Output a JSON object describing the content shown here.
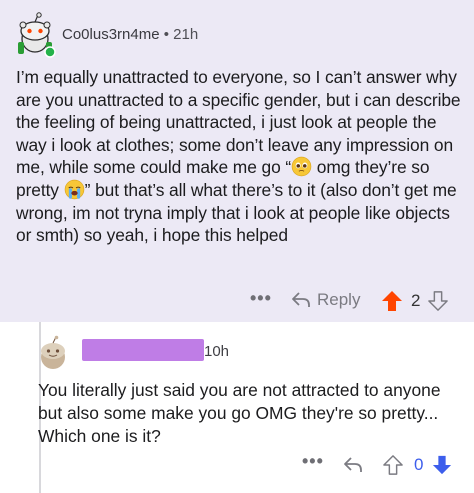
{
  "comment1": {
    "username": "Co0lus3rn4me",
    "separator": "•",
    "time": "21h",
    "text_parts": [
      "I’m equally unattracted to everyone, so I can’t answer why are you unattracted to a specific gender, but i can describe the feeling of being unattracted, i just look at people the way i look at clothes; some don’t leave any impression on me, while some could make me go “",
      " omg they’re so pretty ",
      "” but that’s all what there’s to it (also don’t get me wrong, im not tryna imply that i look at people like objects or smth) so yeah, i hope this helped"
    ],
    "more_label": "•••",
    "reply_label": "Reply",
    "vote_count": "2",
    "upvote_color": "#ff4500"
  },
  "comment2": {
    "time": "10h",
    "text": "You literally just said you are not attracted to anyone but also some make you go OMG they're so pretty... Which one is it?",
    "more_label": "•••",
    "vote_count": "0",
    "downvote_color": "#3d5eec"
  },
  "icons": {
    "avatar": "snoo-avatar-icon",
    "reply": "reply-arrow-icon",
    "upvote": "upvote-arrow-icon",
    "downvote": "downvote-arrow-icon",
    "emoji_pleading": "pleading-face-emoji",
    "emoji_crying": "crying-face-emoji"
  }
}
